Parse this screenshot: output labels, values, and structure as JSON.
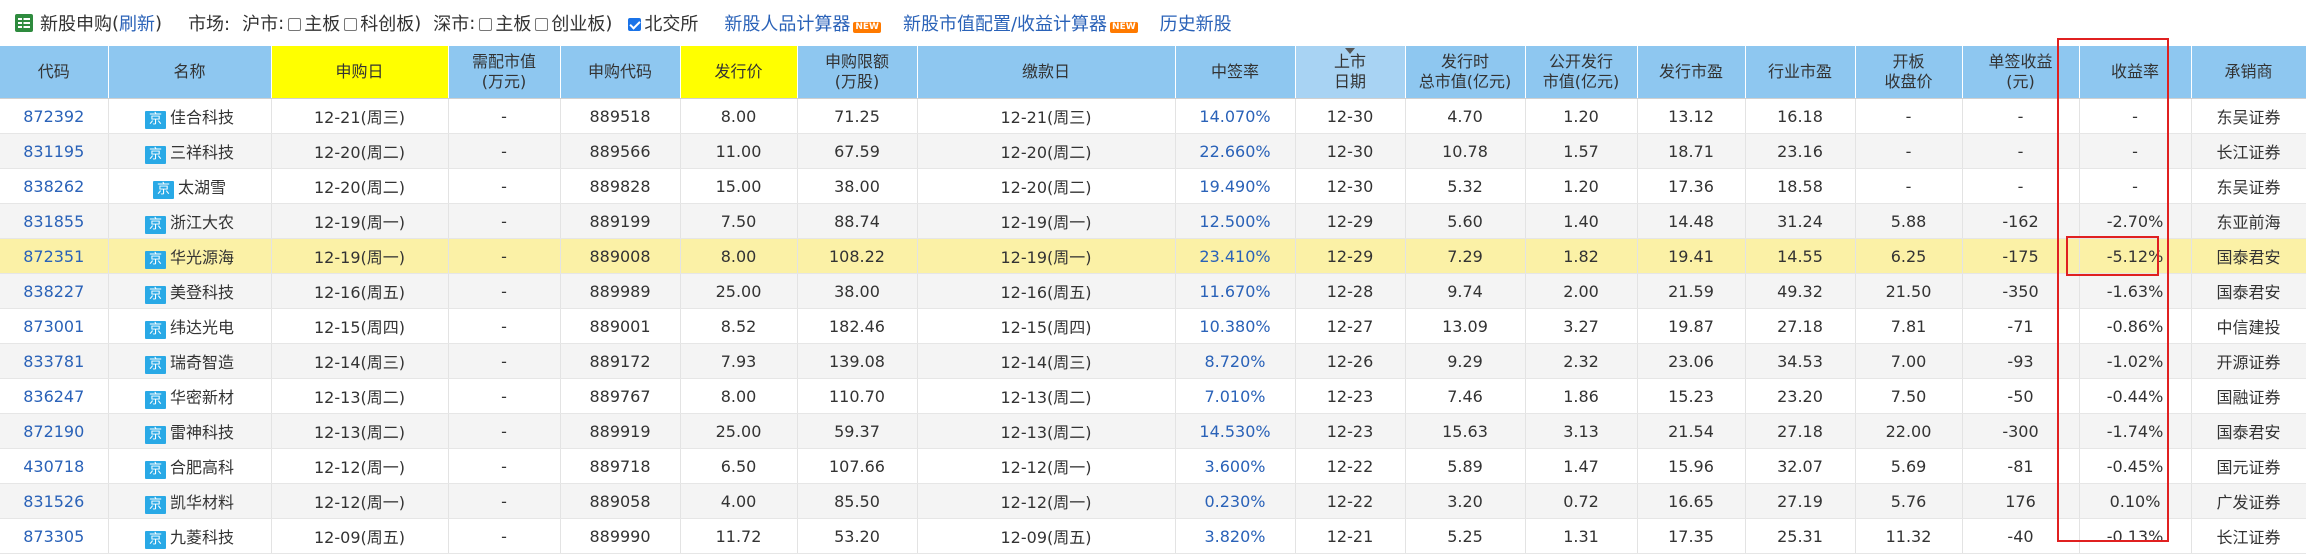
{
  "toolbar": {
    "title": "新股申购",
    "refresh": "刷新",
    "market_label": "市场:",
    "sh_label": "沪市",
    "sh_main": "主板",
    "sh_star": "科创板",
    "sz_label": "深市",
    "sz_main": "主板",
    "sz_gem": "创业板",
    "bj_label": "北交所",
    "link_calc": "新股人品计算器",
    "link_mv": "新股市值配置/收益计算器",
    "link_history": "历史新股",
    "new_badge": "NEW"
  },
  "headers": [
    "代码",
    "名称",
    "申购日",
    "需配市值\n(万元)",
    "申购代码",
    "发行价",
    "申购限额\n(万股)",
    "缴款日",
    "中签率",
    "上市\n日期",
    "发行时\n总市值(亿元)",
    "公开发行\n市值(亿元)",
    "发行市盈",
    "行业市盈",
    "开板\n收盘价",
    "单签收益\n(元)",
    "收益率",
    "承销商"
  ],
  "exchange_badge": "京",
  "rows": [
    {
      "code": "872392",
      "name": "佳合科技",
      "apply_date": "12-21(周三)",
      "mv_req": "-",
      "apply_code": "889518",
      "price": "8.00",
      "limit": "71.25",
      "pay_date": "12-21(周三)",
      "rate": "14.070%",
      "list_date": "12-30",
      "total_mv": "4.70",
      "public_mv": "1.20",
      "pe": "13.12",
      "ind_pe": "16.18",
      "open_close": "-",
      "profit": "-",
      "yield": "-",
      "underwriter": "东吴证券"
    },
    {
      "code": "831195",
      "name": "三祥科技",
      "apply_date": "12-20(周二)",
      "mv_req": "-",
      "apply_code": "889566",
      "price": "11.00",
      "limit": "67.59",
      "pay_date": "12-20(周二)",
      "rate": "22.660%",
      "list_date": "12-30",
      "total_mv": "10.78",
      "public_mv": "1.57",
      "pe": "18.71",
      "ind_pe": "23.16",
      "open_close": "-",
      "profit": "-",
      "yield": "-",
      "underwriter": "长江证券"
    },
    {
      "code": "838262",
      "name": "太湖雪",
      "apply_date": "12-20(周二)",
      "mv_req": "-",
      "apply_code": "889828",
      "price": "15.00",
      "limit": "38.00",
      "pay_date": "12-20(周二)",
      "rate": "19.490%",
      "list_date": "12-30",
      "total_mv": "5.32",
      "public_mv": "1.20",
      "pe": "17.36",
      "ind_pe": "18.58",
      "open_close": "-",
      "profit": "-",
      "yield": "-",
      "underwriter": "东吴证券"
    },
    {
      "code": "831855",
      "name": "浙江大农",
      "apply_date": "12-19(周一)",
      "mv_req": "-",
      "apply_code": "889199",
      "price": "7.50",
      "limit": "88.74",
      "pay_date": "12-19(周一)",
      "rate": "12.500%",
      "list_date": "12-29",
      "total_mv": "5.60",
      "public_mv": "1.40",
      "pe": "14.48",
      "ind_pe": "31.24",
      "open_close": "5.88",
      "profit": "-162",
      "yield": "-2.70%",
      "underwriter": "东亚前海"
    },
    {
      "code": "872351",
      "name": "华光源海",
      "apply_date": "12-19(周一)",
      "mv_req": "-",
      "apply_code": "889008",
      "price": "8.00",
      "limit": "108.22",
      "pay_date": "12-19(周一)",
      "rate": "23.410%",
      "list_date": "12-29",
      "total_mv": "7.29",
      "public_mv": "1.82",
      "pe": "19.41",
      "ind_pe": "14.55",
      "open_close": "6.25",
      "profit": "-175",
      "yield": "-5.12%",
      "underwriter": "国泰君安",
      "highlight": true
    },
    {
      "code": "838227",
      "name": "美登科技",
      "apply_date": "12-16(周五)",
      "mv_req": "-",
      "apply_code": "889989",
      "price": "25.00",
      "limit": "38.00",
      "pay_date": "12-16(周五)",
      "rate": "11.670%",
      "list_date": "12-28",
      "total_mv": "9.74",
      "public_mv": "2.00",
      "pe": "21.59",
      "ind_pe": "49.32",
      "open_close": "21.50",
      "profit": "-350",
      "yield": "-1.63%",
      "underwriter": "国泰君安"
    },
    {
      "code": "873001",
      "name": "纬达光电",
      "apply_date": "12-15(周四)",
      "mv_req": "-",
      "apply_code": "889001",
      "price": "8.52",
      "limit": "182.46",
      "pay_date": "12-15(周四)",
      "rate": "10.380%",
      "list_date": "12-27",
      "total_mv": "13.09",
      "public_mv": "3.27",
      "pe": "19.87",
      "ind_pe": "27.18",
      "open_close": "7.81",
      "profit": "-71",
      "yield": "-0.86%",
      "underwriter": "中信建投"
    },
    {
      "code": "833781",
      "name": "瑞奇智造",
      "apply_date": "12-14(周三)",
      "mv_req": "-",
      "apply_code": "889172",
      "price": "7.93",
      "limit": "139.08",
      "pay_date": "12-14(周三)",
      "rate": "8.720%",
      "list_date": "12-26",
      "total_mv": "9.29",
      "public_mv": "2.32",
      "pe": "23.06",
      "ind_pe": "34.53",
      "open_close": "7.00",
      "profit": "-93",
      "yield": "-1.02%",
      "underwriter": "开源证券"
    },
    {
      "code": "836247",
      "name": "华密新材",
      "apply_date": "12-13(周二)",
      "mv_req": "-",
      "apply_code": "889767",
      "price": "8.00",
      "limit": "110.70",
      "pay_date": "12-13(周二)",
      "rate": "7.010%",
      "list_date": "12-23",
      "total_mv": "7.46",
      "public_mv": "1.86",
      "pe": "15.23",
      "ind_pe": "23.20",
      "open_close": "7.50",
      "profit": "-50",
      "yield": "-0.44%",
      "underwriter": "国融证券"
    },
    {
      "code": "872190",
      "name": "雷神科技",
      "apply_date": "12-13(周二)",
      "mv_req": "-",
      "apply_code": "889919",
      "price": "25.00",
      "limit": "59.37",
      "pay_date": "12-13(周二)",
      "rate": "14.530%",
      "list_date": "12-23",
      "total_mv": "15.63",
      "public_mv": "3.13",
      "pe": "21.54",
      "ind_pe": "27.18",
      "open_close": "22.00",
      "profit": "-300",
      "yield": "-1.74%",
      "underwriter": "国泰君安"
    },
    {
      "code": "430718",
      "name": "合肥高科",
      "apply_date": "12-12(周一)",
      "mv_req": "-",
      "apply_code": "889718",
      "price": "6.50",
      "limit": "107.66",
      "pay_date": "12-12(周一)",
      "rate": "3.600%",
      "list_date": "12-22",
      "total_mv": "5.89",
      "public_mv": "1.47",
      "pe": "15.96",
      "ind_pe": "32.07",
      "open_close": "5.69",
      "profit": "-81",
      "yield": "-0.45%",
      "underwriter": "国元证券"
    },
    {
      "code": "831526",
      "name": "凯华材料",
      "apply_date": "12-12(周一)",
      "mv_req": "-",
      "apply_code": "889058",
      "price": "4.00",
      "limit": "85.50",
      "pay_date": "12-12(周一)",
      "rate": "0.230%",
      "list_date": "12-22",
      "total_mv": "3.20",
      "public_mv": "0.72",
      "pe": "16.65",
      "ind_pe": "27.19",
      "open_close": "5.76",
      "profit": "176",
      "yield": "0.10%",
      "underwriter": "广发证券"
    },
    {
      "code": "873305",
      "name": "九菱科技",
      "apply_date": "12-09(周五)",
      "mv_req": "-",
      "apply_code": "889990",
      "price": "11.72",
      "limit": "53.20",
      "pay_date": "12-09(周五)",
      "rate": "3.820%",
      "list_date": "12-21",
      "total_mv": "5.25",
      "public_mv": "1.31",
      "pe": "17.35",
      "ind_pe": "25.31",
      "open_close": "11.32",
      "profit": "-40",
      "yield": "-0.13%",
      "underwriter": "长江证券"
    }
  ]
}
